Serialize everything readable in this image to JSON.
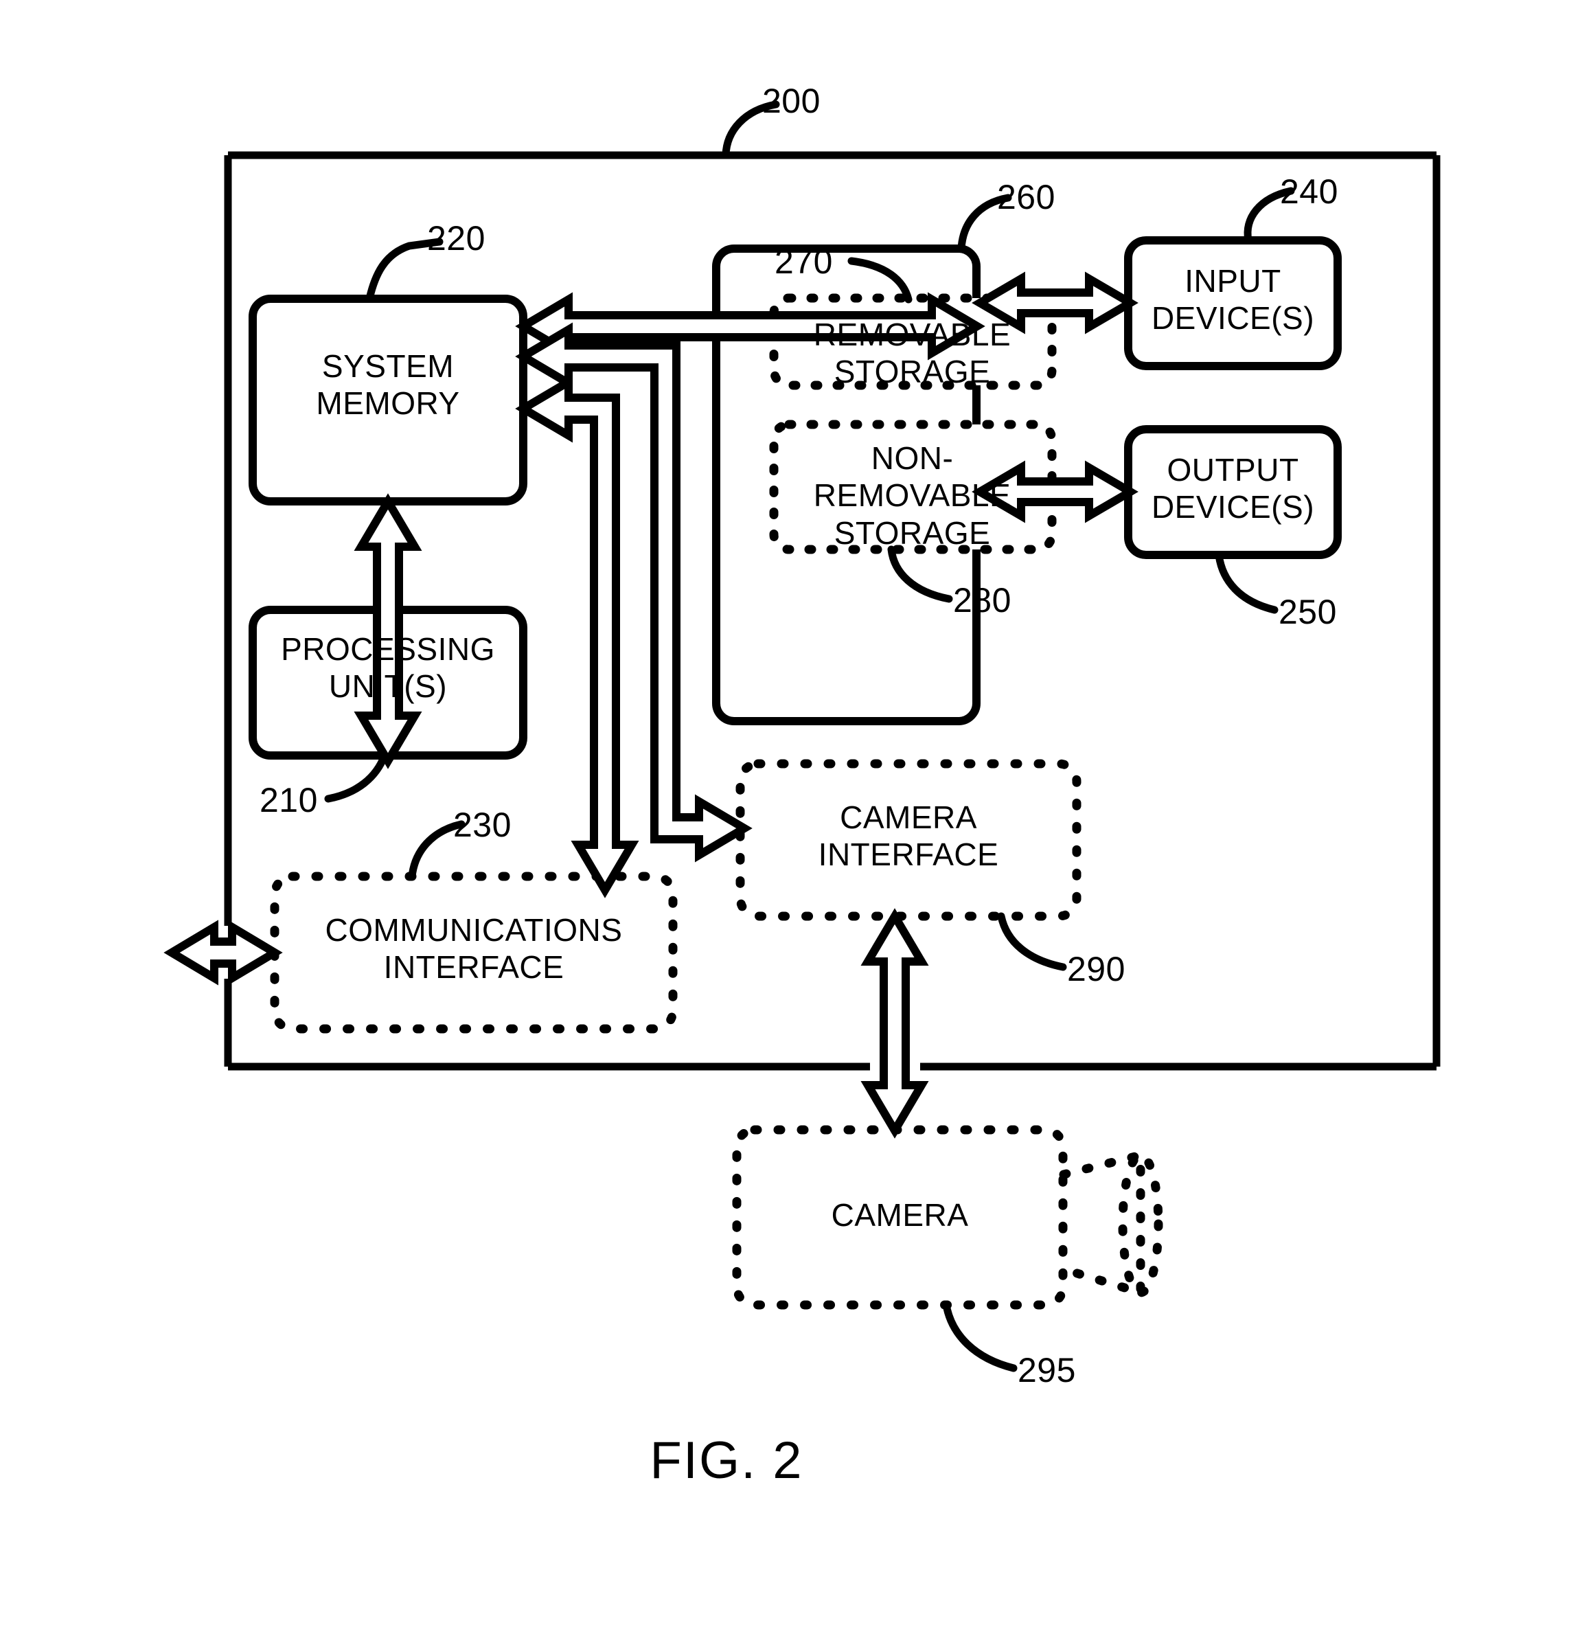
{
  "figure": {
    "caption": "FIG. 2",
    "title_reference": "200"
  },
  "blocks": [
    {
      "id": "system_memory",
      "label": "SYSTEM\nMEMORY",
      "ref": "220",
      "style": "solid-rounded"
    },
    {
      "id": "processing_units",
      "label": "PROCESSING\nUNIT(S)",
      "ref": "210",
      "style": "solid-rounded"
    },
    {
      "id": "communications_iface",
      "label": "COMMUNICATIONS\nINTERFACE",
      "ref": "230",
      "style": "dashed-rounded"
    },
    {
      "id": "storage_container",
      "label": "",
      "ref": "260",
      "style": "solid-rounded"
    },
    {
      "id": "removable_storage",
      "label": "REMOVABLE\nSTORAGE",
      "ref": "270",
      "style": "dashed-rounded"
    },
    {
      "id": "non_removable_storage",
      "label": "NON-\nREMOVABLE\nSTORAGE",
      "ref": "280",
      "style": "dashed-rounded"
    },
    {
      "id": "input_devices",
      "label": "INPUT\nDEVICE(S)",
      "ref": "240",
      "style": "solid-rounded"
    },
    {
      "id": "output_devices",
      "label": "OUTPUT\nDEVICE(S)",
      "ref": "250",
      "style": "solid-rounded"
    },
    {
      "id": "camera_interface",
      "label": "CAMERA\nINTERFACE",
      "ref": "290",
      "style": "dashed-rounded"
    },
    {
      "id": "camera",
      "label": "CAMERA",
      "ref": "295",
      "style": "dashed-rounded-lens"
    }
  ],
  "reference_numerals": {
    "outer_device": "200",
    "processing_units": "210",
    "system_memory": "220",
    "communications_interface": "230",
    "input_devices": "240",
    "output_devices": "250",
    "storage_container": "260",
    "removable_storage": "270",
    "non_removable_storage": "280",
    "camera_interface": "290",
    "camera": "295"
  },
  "labels": {
    "system_memory": "SYSTEM\nMEMORY",
    "processing_units": "PROCESSING\nUNIT(S)",
    "communications_interface": "COMMUNICATIONS\nINTERFACE",
    "removable_storage": "REMOVABLE\nSTORAGE",
    "non_removable_storage": "NON-\nREMOVABLE\nSTORAGE",
    "input_devices": "INPUT\nDEVICE(S)",
    "output_devices": "OUTPUT\nDEVICE(S)",
    "camera_interface": "CAMERA\nINTERFACE",
    "camera": "CAMERA"
  },
  "connections": [
    {
      "from": "system_memory",
      "to": "storage_container",
      "kind": "bidirectional"
    },
    {
      "from": "system_memory",
      "to": "processing_units",
      "kind": "bidirectional"
    },
    {
      "from": "system_memory",
      "to": "communications_iface",
      "kind": "bidirectional"
    },
    {
      "from": "system_memory",
      "to": "camera_interface",
      "kind": "bidirectional"
    },
    {
      "from": "storage_container",
      "to": "input_devices",
      "kind": "bidirectional"
    },
    {
      "from": "storage_container",
      "to": "output_devices",
      "kind": "bidirectional"
    },
    {
      "from": "communications_iface",
      "to": "external",
      "kind": "bidirectional"
    },
    {
      "from": "camera_interface",
      "to": "camera",
      "kind": "bidirectional"
    }
  ],
  "colors": {
    "stroke": "#000000",
    "background": "#ffffff"
  }
}
